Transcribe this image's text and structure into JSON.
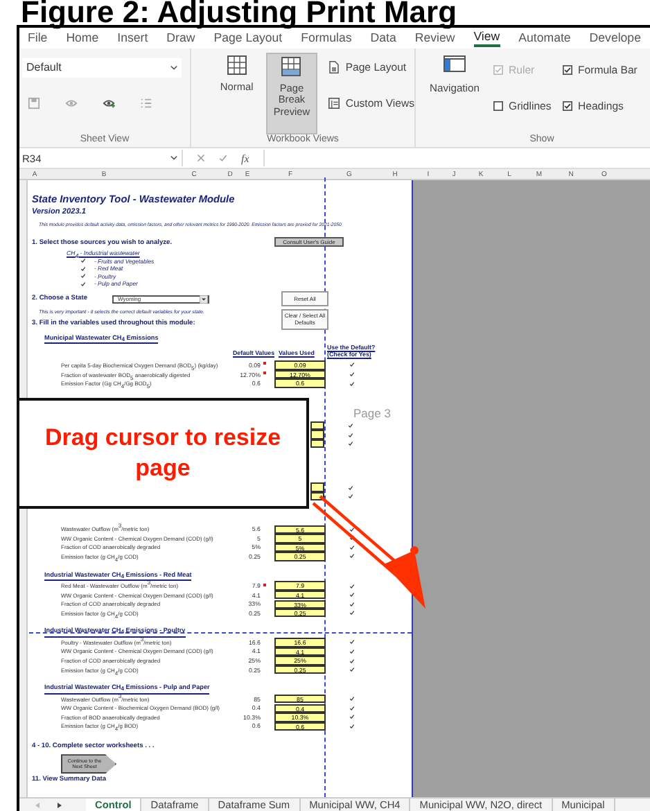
{
  "caption": "Figure 2: Adjusting Print Marg",
  "ribbon_tabs": [
    {
      "label": "File",
      "selected": false
    },
    {
      "label": "Home",
      "selected": false
    },
    {
      "label": "Insert",
      "selected": false
    },
    {
      "label": "Draw",
      "selected": false
    },
    {
      "label": "Page Layout",
      "selected": false
    },
    {
      "label": "Formulas",
      "selected": false
    },
    {
      "label": "Data",
      "selected": false
    },
    {
      "label": "Review",
      "selected": false
    },
    {
      "label": "View",
      "selected": true
    },
    {
      "label": "Automate",
      "selected": false
    },
    {
      "label": "Develope",
      "selected": false
    }
  ],
  "sheet_view": {
    "dropdown": "Default",
    "label": "Sheet View"
  },
  "workbook_views": {
    "label": "Workbook Views",
    "views": [
      {
        "label": "Normal",
        "selected": false
      },
      {
        "label": "Page Break Preview",
        "selected": true
      }
    ],
    "page_layout": "Page Layout",
    "custom_views": "Custom Views"
  },
  "show": {
    "label": "Show",
    "navigation": "Navigation",
    "options": [
      {
        "label": "Ruler",
        "checked": true,
        "disabled": true
      },
      {
        "label": "Formula Bar",
        "checked": true,
        "disabled": false
      },
      {
        "label": "Gridlines",
        "checked": false,
        "disabled": false
      },
      {
        "label": "Headings",
        "checked": true,
        "disabled": false
      }
    ]
  },
  "formula_bar": {
    "name_box": "R34",
    "fx": "fx"
  },
  "columns": [
    "A",
    "B",
    "C",
    "D",
    "E",
    "F",
    "G",
    "H",
    "I",
    "J",
    "K",
    "L",
    "M",
    "N",
    "O"
  ],
  "sheet": {
    "title": "State Inventory Tool - Wastewater Module",
    "version": "Version 2023.1",
    "description": "This module provides default activity data, emission factors, and other relevant metrics for 1990-2020. Emission factors are proxied for 2021-2050",
    "step1": "1. Select those sources you wish to analyze.",
    "guide_button": "Consult User's Guide",
    "source_group": "CH$_{4}$ - Industrial wastewater",
    "sources": [
      {
        "label": "- Fruits and Vegetables",
        "checked": true
      },
      {
        "label": "- Red Meat",
        "checked": true
      },
      {
        "label": "- Poultry",
        "checked": true
      },
      {
        "label": "- Pulp and Paper",
        "checked": true
      }
    ],
    "step2": "2. Choose a State",
    "state": "Wyoming",
    "reset_button": "Reset All",
    "state_note": "This is very important - it selects the correct default variables for your state.",
    "clear_button": "Clear / Select All Defaults",
    "step3": "3. Fill in the variables used throughout this module:",
    "headers": {
      "default": "Default Values",
      "used": "Values Used",
      "use_default": "Use the Default? (Check for Yes)"
    },
    "tables": [
      {
        "heading": "Municipal Wastewater CH$_{4}$ Emissions",
        "rows": [
          {
            "label": "Per capita 5-day Biochemical Oxygen Demand (BOD$_{5}$) (kg/day)",
            "default": "0.09",
            "used": "0.09",
            "checked": true,
            "comment": true
          },
          {
            "label": "Fraction of wastewater BOD$_{5}$ anaerobically digested",
            "default": "12.70%",
            "used": "12.70%",
            "checked": true,
            "comment": true
          },
          {
            "label": "Emission Factor (Gg CH$_{4}$/Gg BOD$_{5}$)",
            "default": "0.6",
            "used": "0.6",
            "checked": true,
            "comment": false
          }
        ]
      },
      {
        "rows": [
          {
            "label": "Wastewater Outflow (m$^{3}$/metric ton)",
            "default": "5.6",
            "used": "5.6",
            "checked": true,
            "comment": false
          },
          {
            "label": "WW Organic Content - Chemical Oxygen Demand (COD) (g/l)",
            "default": "5",
            "used": "5",
            "checked": true,
            "comment": false
          },
          {
            "label": "Fraction of COD anaerobically degraded",
            "default": "5%",
            "used": "5%",
            "checked": true,
            "comment": false
          },
          {
            "label": "Emission factor (g CH$_{4}$/g COD)",
            "default": "0.25",
            "used": "0.25",
            "checked": true,
            "comment": false
          }
        ]
      },
      {
        "heading": "Industrial Wastewater CH$_{4}$ Emissions - Red Meat",
        "rows": [
          {
            "label": "Red Meat - Wastewater Outflow (m$^{3}$/metric ton)",
            "default": "7.9",
            "used": "7.9",
            "checked": true,
            "comment": true
          },
          {
            "label": "WW Organic Content - Chemical Oxygen Demand (COD) (g/l)",
            "default": "4.1",
            "used": "4.1",
            "checked": true,
            "comment": false
          },
          {
            "label": "Fraction of COD anaerobically degraded",
            "default": "33%",
            "used": "33%",
            "checked": true,
            "comment": false
          },
          {
            "label": "Emission factor (g CH$_{4}$/g COD)",
            "default": "0.25",
            "used": "0.25",
            "checked": true,
            "comment": false
          }
        ]
      },
      {
        "heading": "Industrial Wastewater CH$_{4}$ Emissions - Poultry",
        "rows": [
          {
            "label": "Poultry - Wastewater Outflow (m$^{3}$/metric ton)",
            "default": "16.6",
            "used": "16.6",
            "checked": true,
            "comment": false
          },
          {
            "label": "WW Organic Content - Chemical Oxygen Demand (COD) (g/l)",
            "default": "4.1",
            "used": "4.1",
            "checked": true,
            "comment": false
          },
          {
            "label": "Fraction of COD anaerobically degraded",
            "default": "25%",
            "used": "25%",
            "checked": true,
            "comment": false
          },
          {
            "label": "Emission factor (g CH$_{4}$/g COD)",
            "default": "0.25",
            "used": "0.25",
            "checked": true,
            "comment": false
          }
        ]
      },
      {
        "heading": "Industrial Wastewater CH$_{4}$ Emissions - Pulp and Paper",
        "rows": [
          {
            "label": "Wastewater Outflow (m$^{3}$/metric ton)",
            "default": "85",
            "used": "85",
            "checked": true,
            "comment": false
          },
          {
            "label": "WW Organic Content - Biochemical Oxygen Demand (BOD) (g/l)",
            "default": "0.4",
            "used": "0.4",
            "checked": true,
            "comment": false
          },
          {
            "label": "Fraction of BOD anaerobically degraded",
            "default": "10.3%",
            "used": "10.3%",
            "checked": true,
            "comment": false
          },
          {
            "label": "Emission factor (g CH$_{4}$/g BOD)",
            "default": "0.6",
            "used": "0.6",
            "checked": true,
            "comment": false
          }
        ]
      }
    ],
    "covered_groups": [
      [
        {
          "checked": true
        },
        {
          "checked": true
        },
        {
          "checked": true
        }
      ],
      [
        {
          "checked": true
        },
        {
          "checked": true
        }
      ]
    ],
    "step4": "4 - 10. Complete sector worksheets . . .",
    "continue_button": "Continue to the Next Sheet",
    "step11": "11. View Summary Data"
  },
  "page_label": "Page 3",
  "callout": "Drag cursor to resize page",
  "sheet_tabs": [
    {
      "label": "Control",
      "selected": true
    },
    {
      "label": "Dataframe",
      "selected": false
    },
    {
      "label": "Dataframe Sum",
      "selected": false
    },
    {
      "label": "Municipal WW, CH4",
      "selected": false
    },
    {
      "label": "Municipal WW, N2O, direct",
      "selected": false
    },
    {
      "label": "Municipal",
      "selected": false
    }
  ]
}
